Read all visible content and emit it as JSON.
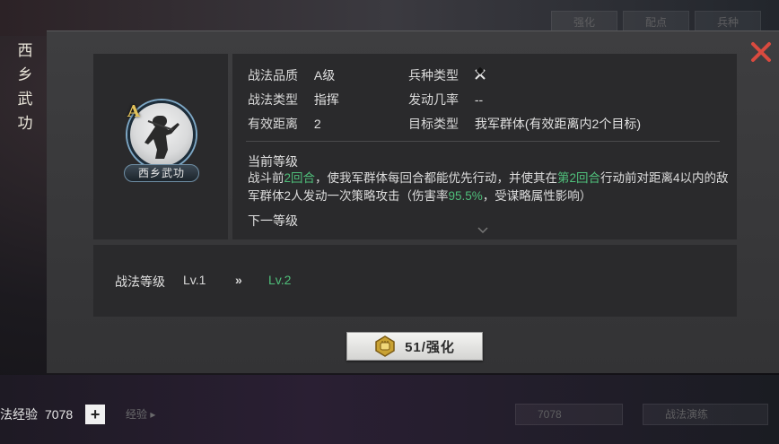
{
  "background": {
    "top_tabs": [
      "强化",
      "配点",
      "兵种"
    ],
    "bottom_left_faded": "经验 ▸",
    "bottom_right_value": "7078",
    "bottom_right_button": "战法演练"
  },
  "sidebar": {
    "title_chars": [
      "西",
      "乡",
      "武",
      "功"
    ]
  },
  "hero": {
    "grade": "A",
    "name": "西乡武功"
  },
  "info": {
    "quality_label": "战法品质",
    "quality_value": "A级",
    "troop_label": "兵种类型",
    "troop_icon": "crossed-swords-icon",
    "type_label": "战法类型",
    "type_value": "指挥",
    "chance_label": "发动几率",
    "chance_value": "--",
    "range_label": "有效距离",
    "range_value": "2",
    "target_label": "目标类型",
    "target_value": "我军群体(有效距离内2个目标)",
    "current_level_label": "当前等级",
    "desc": {
      "p1": "战斗前",
      "h1": "2回合",
      "p2": "，使我军群体每回合都能优先行动，并使其在",
      "h2": "第2回合",
      "p3": "行动前对距离4以内的敌军群体2人发动一次策略攻击（伤害率",
      "h3": "95.5%",
      "p4": "，受谋略属性影响）"
    },
    "next_level_label": "下一等级"
  },
  "level": {
    "label": "战法等级",
    "current": "Lv.1",
    "arrow": "»",
    "next": "Lv.2"
  },
  "upgrade": {
    "label": "51/强化"
  },
  "footer": {
    "exp_label": "法经验",
    "exp_value": "7078",
    "plus": "+"
  },
  "colors": {
    "highlight": "#4fbf7a",
    "close": "#d94a3f",
    "grade": "#e3c25a"
  }
}
